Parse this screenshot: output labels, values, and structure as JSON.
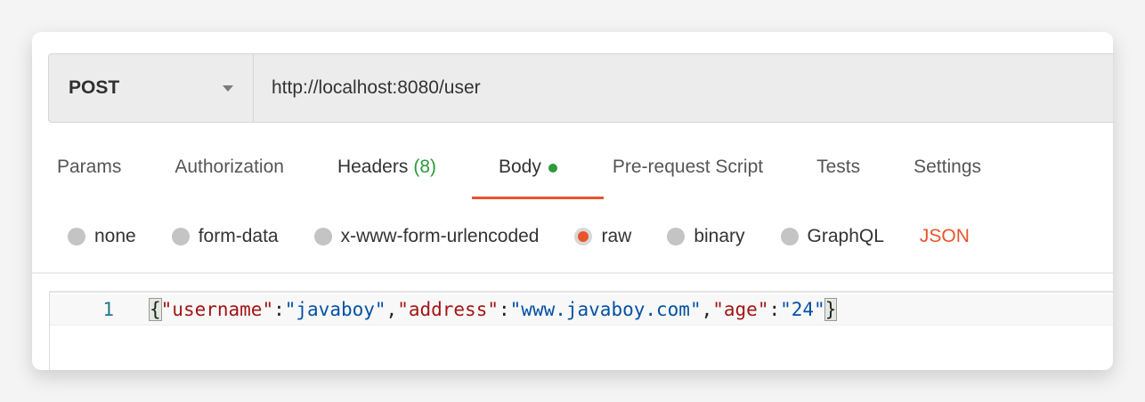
{
  "request": {
    "method": "POST",
    "url": "http://localhost:8080/user"
  },
  "tabs": [
    {
      "label": "Params"
    },
    {
      "label": "Authorization"
    },
    {
      "label": "Headers",
      "count": "(8)"
    },
    {
      "label": "Body"
    },
    {
      "label": "Pre-request Script"
    },
    {
      "label": "Tests"
    },
    {
      "label": "Settings"
    }
  ],
  "body_types": [
    "none",
    "form-data",
    "x-www-form-urlencoded",
    "raw",
    "binary",
    "GraphQL"
  ],
  "selected_body_type": "raw",
  "format": "JSON",
  "editor": {
    "line_number": "1",
    "tokens": [
      "{",
      "\"username\"",
      ":",
      "\"javaboy\"",
      ",",
      "\"address\"",
      ":",
      "\"www.javaboy.com\"",
      ",",
      "\"age\"",
      ":",
      "\"24\"",
      "}"
    ]
  },
  "colors": {
    "accent": "#e8542b",
    "count": "#2c9a3a",
    "key": "#a31515",
    "value": "#0451a5"
  }
}
